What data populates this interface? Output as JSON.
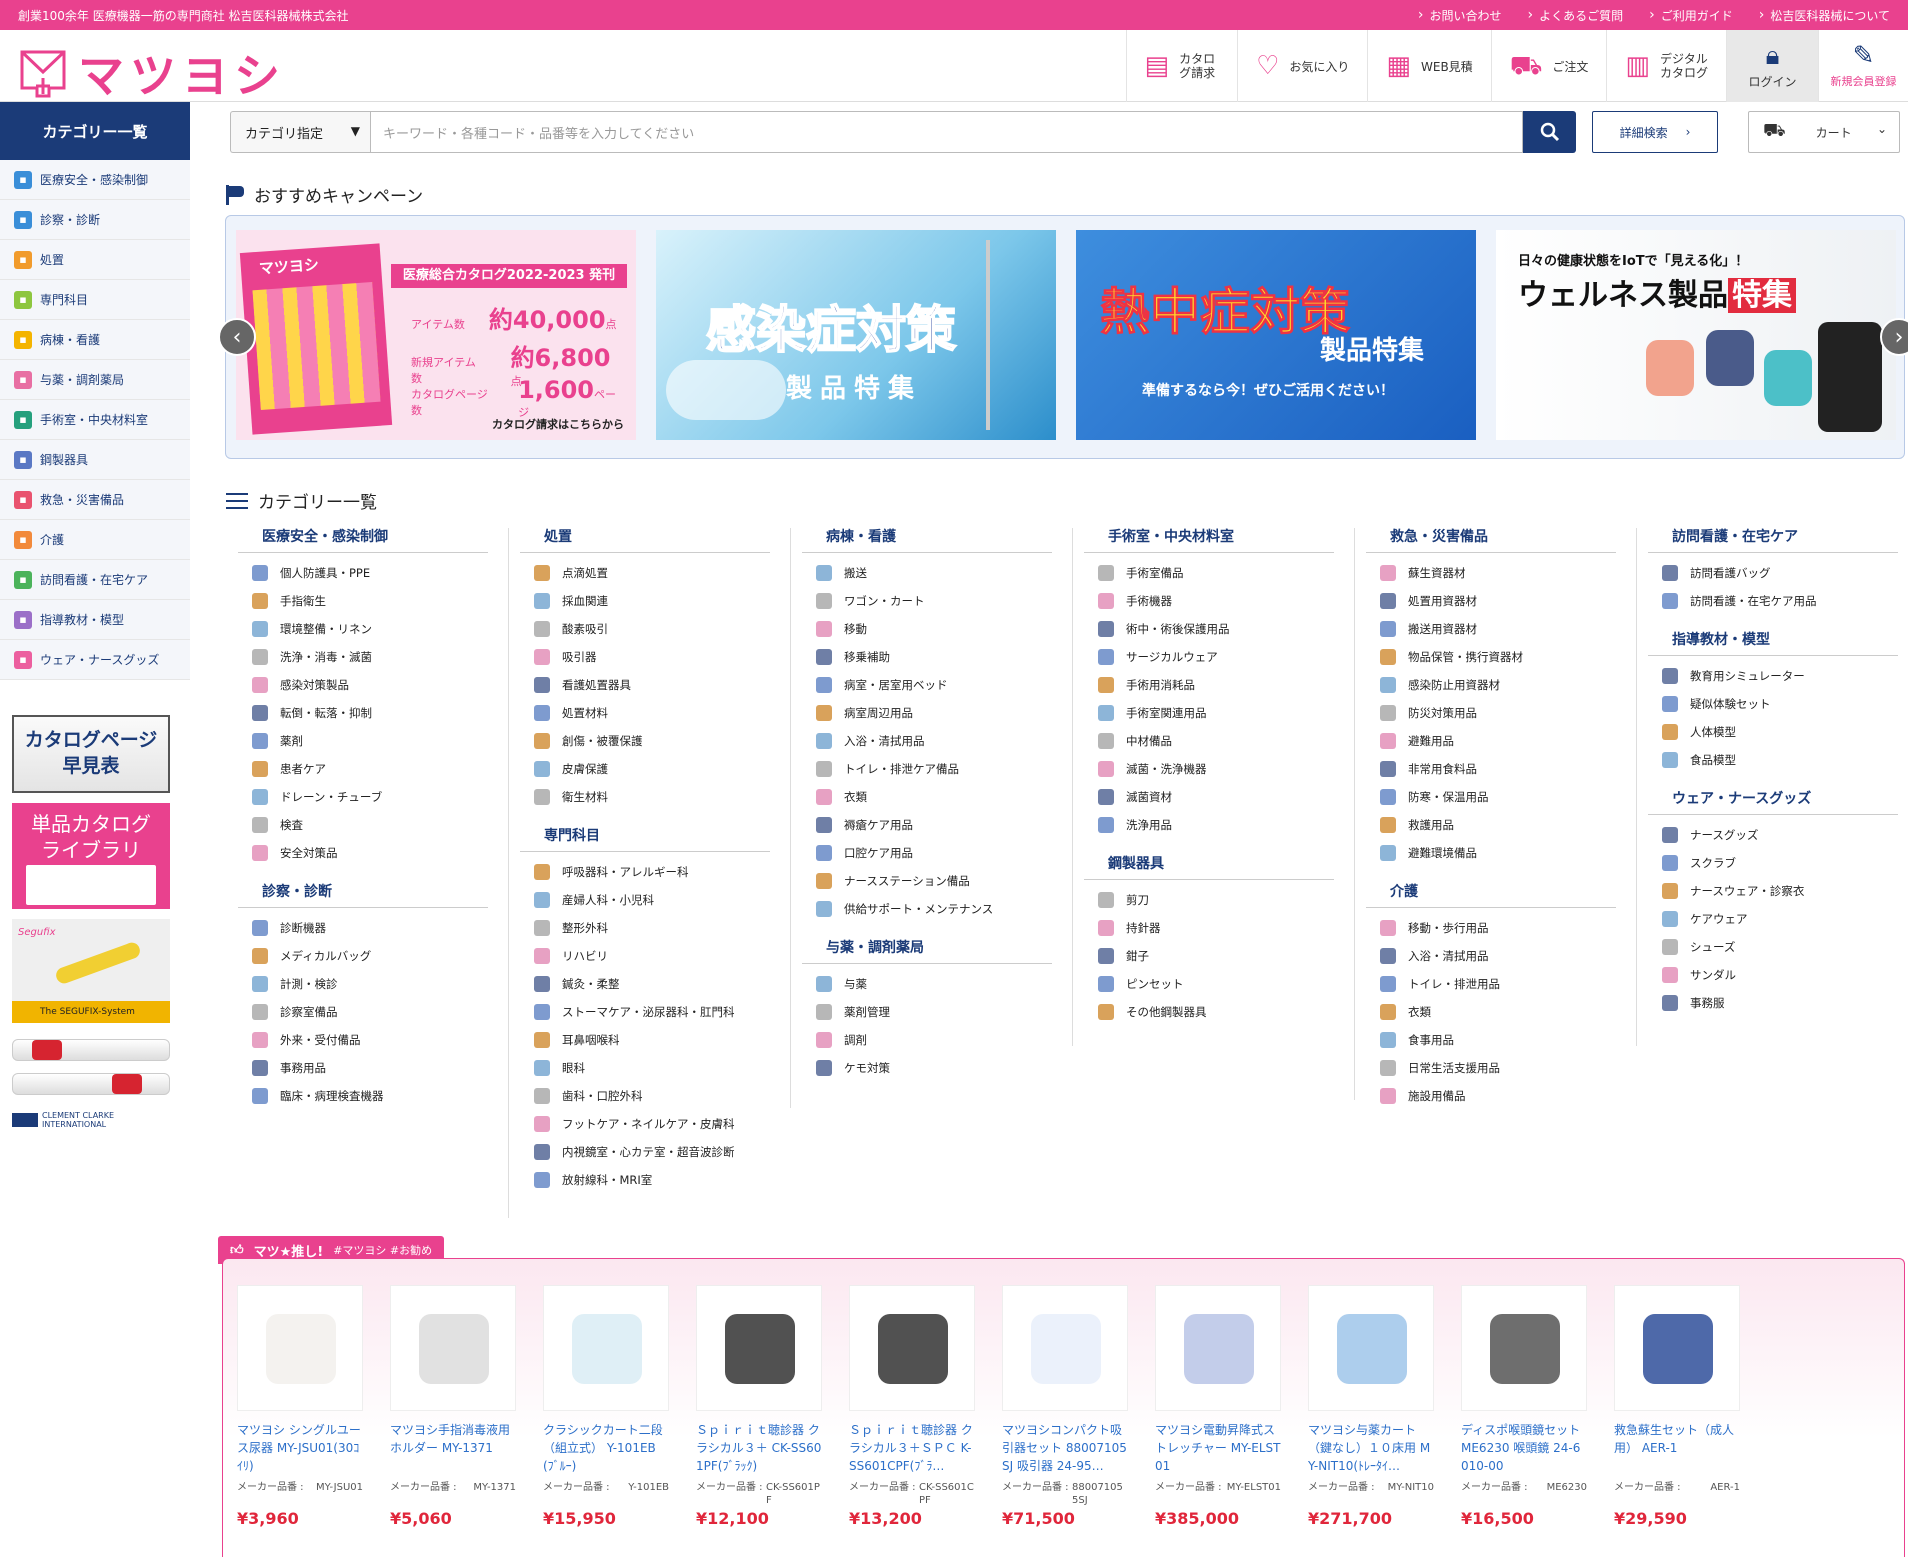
{
  "topbar": {
    "tagline": "創業100余年 医療機器一筋の専門商社 松吉医科器械株式会社",
    "links": [
      "お問い合わせ",
      "よくあるご質問",
      "ご利用ガイド",
      "松吉医科器械について"
    ]
  },
  "header": {
    "logo": "マツヨシ",
    "nav": [
      {
        "label": "カタログ請求",
        "icon": "catalog-icon"
      },
      {
        "label": "お気に入り",
        "icon": "heart-icon"
      },
      {
        "label": "WEB見積",
        "icon": "estimate-icon"
      },
      {
        "label": "ご注文",
        "icon": "cart-icon"
      },
      {
        "label": "デジタルカタログ",
        "icon": "book-icon"
      }
    ],
    "login": "ログイン",
    "register": "新規会員登録"
  },
  "colors": {
    "brand_pink": "#e9418e",
    "navy": "#1b3b78",
    "link_blue": "#2c6fc9",
    "price_red": "#e0263b"
  },
  "sidebar": {
    "title": "カテゴリー一覧",
    "items": [
      {
        "label": "医療安全・感染制御",
        "color": "#3a8ed8"
      },
      {
        "label": "診察・診断",
        "color": "#3a8ed8"
      },
      {
        "label": "処置",
        "color": "#f19b2c"
      },
      {
        "label": "専門科目",
        "color": "#8dc63f"
      },
      {
        "label": "病棟・看護",
        "color": "#f4b400"
      },
      {
        "label": "与薬・調剤薬局",
        "color": "#e86fa3"
      },
      {
        "label": "手術室・中央材料室",
        "color": "#25a07d"
      },
      {
        "label": "鋼製器具",
        "color": "#5a78c4"
      },
      {
        "label": "救急・災害備品",
        "color": "#e9536f"
      },
      {
        "label": "介護",
        "color": "#f28a3b"
      },
      {
        "label": "訪問看護・在宅ケア",
        "color": "#4bb35b"
      },
      {
        "label": "指導教材・模型",
        "color": "#9b6fc8"
      },
      {
        "label": "ウェア・ナースグッズ",
        "color": "#ec5f9f"
      }
    ],
    "banners": {
      "page_index_line1": "カタログページ",
      "page_index_line2": "早見表",
      "library_line1": "単品カタログ",
      "library_line2": "ライブラリ",
      "segufix_logo": "Segufix",
      "segufix_caption": "The SEGUFIX-System",
      "clement_caption": "CLEMENT CLARKE INTERNATIONAL"
    }
  },
  "search": {
    "category_select": "カテゴリ指定",
    "placeholder": "キーワード・各種コード・品番等を入力してください",
    "advanced": "詳細検索",
    "cart": "カート"
  },
  "campaign": {
    "title": "おすすめキャンペーン",
    "slide1": {
      "book_logo": "マツヨシ",
      "headline": "医療総合カタログ2022-2023 発刊",
      "rows": [
        {
          "label": "アイテム数",
          "value": "約40,000",
          "unit": "点"
        },
        {
          "label": "新規アイテム数",
          "value": "約6,800",
          "unit": "点"
        },
        {
          "label": "カタログページ数",
          "value": "1,600",
          "unit": "ページ"
        }
      ],
      "cta": "カタログ請求はこちらから"
    },
    "slide2": {
      "title": "感染症対策",
      "sub": "製品特集"
    },
    "slide3": {
      "title": "熱中症対策",
      "sub": "製品特集",
      "note": "準備するなら今！ぜひご活用ください！"
    },
    "slide4": {
      "kicker": "日々の健康状態をIoTで「見える化」！",
      "title": "ウェルネス製品",
      "badge": "特集"
    }
  },
  "categories": {
    "title": "カテゴリー一覧",
    "columns": [
      [
        {
          "heading": "医療安全・感染制御",
          "items": [
            "個人防護具・PPE",
            "手指衛生",
            "環境整備・リネン",
            "洗浄・消毒・滅菌",
            "感染対策製品",
            "転倒・転落・抑制",
            "薬剤",
            "患者ケア",
            "ドレーン・チューブ",
            "検査",
            "安全対策品"
          ]
        },
        {
          "heading": "診察・診断",
          "items": [
            "診断機器",
            "メディカルバッグ",
            "計測・検診",
            "診察室備品",
            "外来・受付備品",
            "事務用品",
            "臨床・病理検査機器"
          ]
        }
      ],
      [
        {
          "heading": "処置",
          "items": [
            "点滴処置",
            "採血関連",
            "酸素吸引",
            "吸引器",
            "看護処置器具",
            "処置材料",
            "創傷・被覆保護",
            "皮膚保護",
            "衛生材料"
          ]
        },
        {
          "heading": "専門科目",
          "items": [
            "呼吸器科・アレルギー科",
            "産婦人科・小児科",
            "整形外科",
            "リハビリ",
            "鍼灸・柔整",
            "ストーマケア・泌尿器科・肛門科",
            "耳鼻咽喉科",
            "眼科",
            "歯科・口腔外科",
            "フットケア・ネイルケア・皮膚科",
            "内視鏡室・心カテ室・超音波診断",
            "放射線科・MRI室"
          ]
        }
      ],
      [
        {
          "heading": "病棟・看護",
          "items": [
            "搬送",
            "ワゴン・カート",
            "移動",
            "移乗補助",
            "病室・居室用ベッド",
            "病室周辺用品",
            "入浴・清拭用品",
            "トイレ・排泄ケア備品",
            "衣類",
            "褥瘡ケア用品",
            "口腔ケア用品",
            "ナースステーション備品",
            "供給サポート・メンテナンス"
          ]
        },
        {
          "heading": "与薬・調剤薬局",
          "items": [
            "与薬",
            "薬剤管理",
            "調剤",
            "ケモ対策"
          ]
        }
      ],
      [
        {
          "heading": "手術室・中央材料室",
          "items": [
            "手術室備品",
            "手術機器",
            "術中・術後保護用品",
            "サージカルウェア",
            "手術用消耗品",
            "手術室関連用品",
            "中材備品",
            "滅菌・洗浄機器",
            "滅菌資材",
            "洗浄用品"
          ]
        },
        {
          "heading": "鋼製器具",
          "items": [
            "剪刀",
            "持針器",
            "鉗子",
            "ピンセット",
            "その他鋼製器具"
          ]
        }
      ],
      [
        {
          "heading": "救急・災害備品",
          "items": [
            "蘇生資器材",
            "処置用資器材",
            "搬送用資器材",
            "物品保管・携行資器材",
            "感染防止用資器材",
            "防災対策用品",
            "避難用品",
            "非常用食料品",
            "防寒・保温用品",
            "救護用品",
            "避難環境備品"
          ]
        },
        {
          "heading": "介護",
          "items": [
            "移動・歩行用品",
            "入浴・清拭用品",
            "トイレ・排泄用品",
            "衣類",
            "食事用品",
            "日常生活支援用品",
            "施設用備品"
          ]
        }
      ],
      [
        {
          "heading": "訪問看護・在宅ケア",
          "items": [
            "訪問看護バッグ",
            "訪問看護・在宅ケア用品"
          ]
        },
        {
          "heading": "指導教材・模型",
          "items": [
            "教育用シミュレーター",
            "疑似体験セット",
            "人体模型",
            "食品模型"
          ]
        },
        {
          "heading": "ウェア・ナースグッズ",
          "items": [
            "ナースグッズ",
            "スクラブ",
            "ナースウェア・診察衣",
            "ケアウェア",
            "シューズ",
            "サンダル",
            "事務服"
          ]
        }
      ]
    ]
  },
  "recommend": {
    "tag": "マツ★推し!",
    "hashtags": "#マツヨシ #お勧め",
    "maker_label": "メーカー品番 :",
    "products": [
      {
        "name": "マツヨシ シングルユース尿器 MY-JSU01(30ｺｲﾘ)",
        "code": "MY-JSU01",
        "price": "¥3,960"
      },
      {
        "name": "マツヨシ手指消毒液用ホルダー MY-1371",
        "code": "MY-1371",
        "price": "¥5,060"
      },
      {
        "name": "クラシックカート二段（組立式） Y-101EB(ﾌﾞﾙｰ)",
        "code": "Y-101EB",
        "price": "¥15,950"
      },
      {
        "name": "Ｓｐｉｒｉｔ聴診器 クラシカル３＋ CK-SS601PF(ﾌﾞﾗｯｸ)",
        "code": "CK-SS601PF",
        "price": "¥12,100"
      },
      {
        "name": "Ｓｐｉｒｉｔ聴診器 クラシカル３＋ＳＰＣ K-SS601CPF(ﾌﾞﾗ…",
        "code": "CK-SS601CPF",
        "price": "¥13,200"
      },
      {
        "name": "マツヨシコンパクト吸引器セット 88007105SJ 吸引器 24-95…",
        "code": "880071055SJ",
        "price": "¥71,500"
      },
      {
        "name": "マツヨシ電動昇降式ストレッチャー MY-ELST01",
        "code": "MY-ELST01",
        "price": "¥385,000"
      },
      {
        "name": "マツヨシ与薬カート（鍵なし）１０床用 MY-NIT10(ﾄﾚｰﾀｲ…",
        "code": "MY-NIT10",
        "price": "¥271,700"
      },
      {
        "name": "ディスポ喉頭鏡セット ME6230 喉頭鏡 24-6010-00",
        "code": "ME6230",
        "price": "¥16,500"
      },
      {
        "name": "救急蘇生セット（成人用） AER-1",
        "code": "AER-1",
        "price": "¥29,590"
      }
    ]
  }
}
